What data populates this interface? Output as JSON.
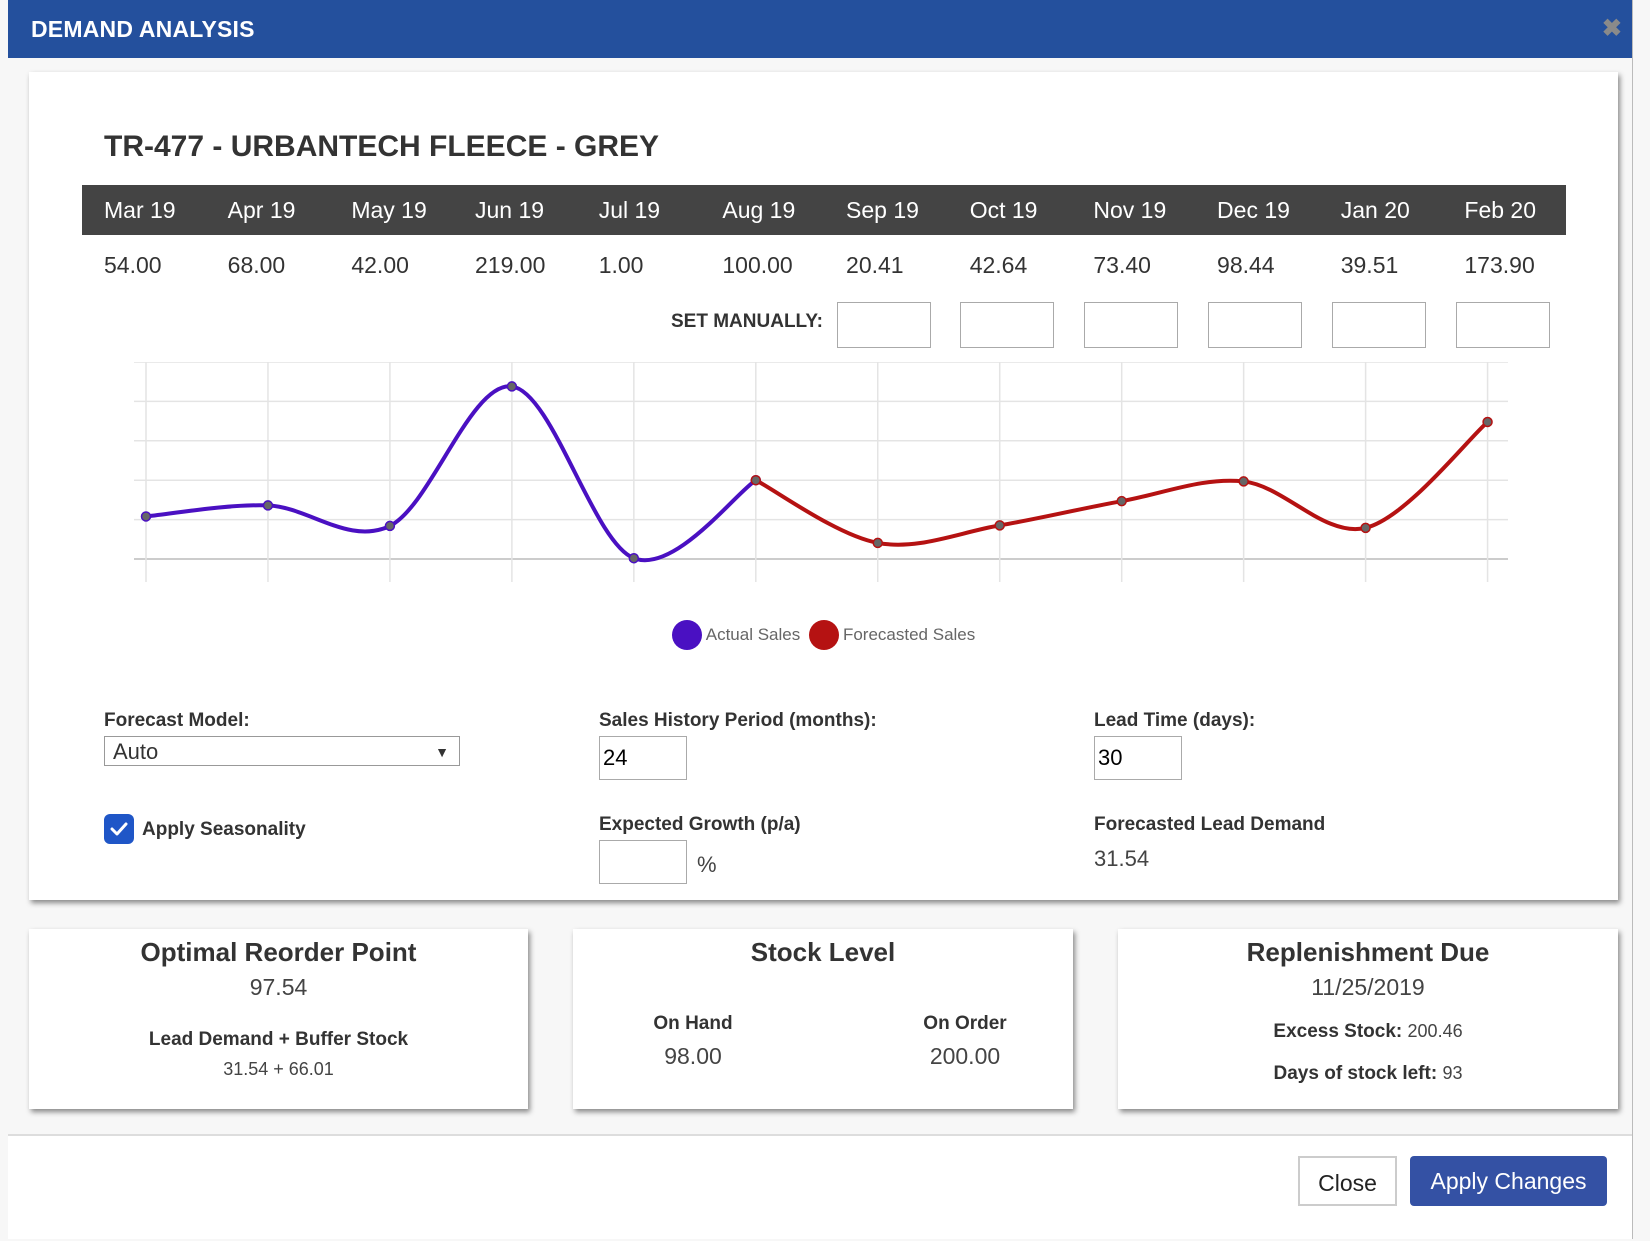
{
  "header": {
    "title": "DEMAND ANALYSIS",
    "close_icon": "close-x-icon"
  },
  "product": {
    "title": "TR-477 - URBANTECH FLEECE - GREY"
  },
  "months": [
    "Mar 19",
    "Apr 19",
    "May 19",
    "Jun 19",
    "Jul 19",
    "Aug 19",
    "Sep 19",
    "Oct 19",
    "Nov 19",
    "Dec 19",
    "Jan 20",
    "Feb 20"
  ],
  "values": [
    "54.00",
    "68.00",
    "42.00",
    "219.00",
    "1.00",
    "100.00",
    "20.41",
    "42.64",
    "73.40",
    "98.44",
    "39.51",
    "173.90"
  ],
  "set_manually": {
    "label": "SET MANUALLY:",
    "inputs": [
      "",
      "",
      "",
      "",
      "",
      ""
    ]
  },
  "chart_data": {
    "type": "line",
    "title": "",
    "xlabel": "",
    "ylabel": "",
    "categories": [
      "Mar 19",
      "Apr 19",
      "May 19",
      "Jun 19",
      "Jul 19",
      "Aug 19",
      "Sep 19",
      "Oct 19",
      "Nov 19",
      "Dec 19",
      "Jan 20",
      "Feb 20"
    ],
    "series": [
      {
        "name": "Actual Sales",
        "color": "#4a10c2",
        "values": [
          54,
          68,
          42,
          219,
          1,
          100,
          null,
          null,
          null,
          null,
          null,
          null
        ]
      },
      {
        "name": "Forecasted Sales",
        "color": "#b51212",
        "values": [
          null,
          null,
          null,
          null,
          null,
          100,
          20.41,
          42.64,
          73.4,
          98.44,
          39.51,
          173.9
        ]
      }
    ],
    "ylim": [
      0,
      250
    ],
    "grid": true,
    "legend": "bottom"
  },
  "legend": [
    {
      "label": "Actual Sales",
      "color": "#4a10c2"
    },
    {
      "label": "Forecasted Sales",
      "color": "#b51212"
    }
  ],
  "form": {
    "forecast_model_label": "Forecast Model:",
    "forecast_model_value": "Auto",
    "apply_seasonality_label": "Apply Seasonality",
    "apply_seasonality_checked": true,
    "sales_history_label": "Sales History Period (months):",
    "sales_history_value": "24",
    "expected_growth_label": "Expected Growth (p/a)",
    "expected_growth_value": "",
    "expected_growth_unit": "%",
    "lead_time_label": "Lead Time (days):",
    "lead_time_value": "30",
    "forecasted_lead_demand_label": "Forecasted Lead Demand",
    "forecasted_lead_demand_value": "31.54"
  },
  "cards": {
    "reorder": {
      "title": "Optimal Reorder Point",
      "value": "97.54",
      "sub_label": "Lead Demand + Buffer Stock",
      "sub_value": "31.54 + 66.01"
    },
    "stock": {
      "title": "Stock Level",
      "on_hand_label": "On Hand",
      "on_hand_value": "98.00",
      "on_order_label": "On Order",
      "on_order_value": "200.00"
    },
    "replenishment": {
      "title": "Replenishment Due",
      "date": "11/25/2019",
      "excess_label": "Excess Stock:",
      "excess_value": "200.46",
      "days_label": "Days of stock left:",
      "days_value": "93"
    }
  },
  "footer": {
    "close_label": "Close",
    "apply_label": "Apply Changes"
  }
}
